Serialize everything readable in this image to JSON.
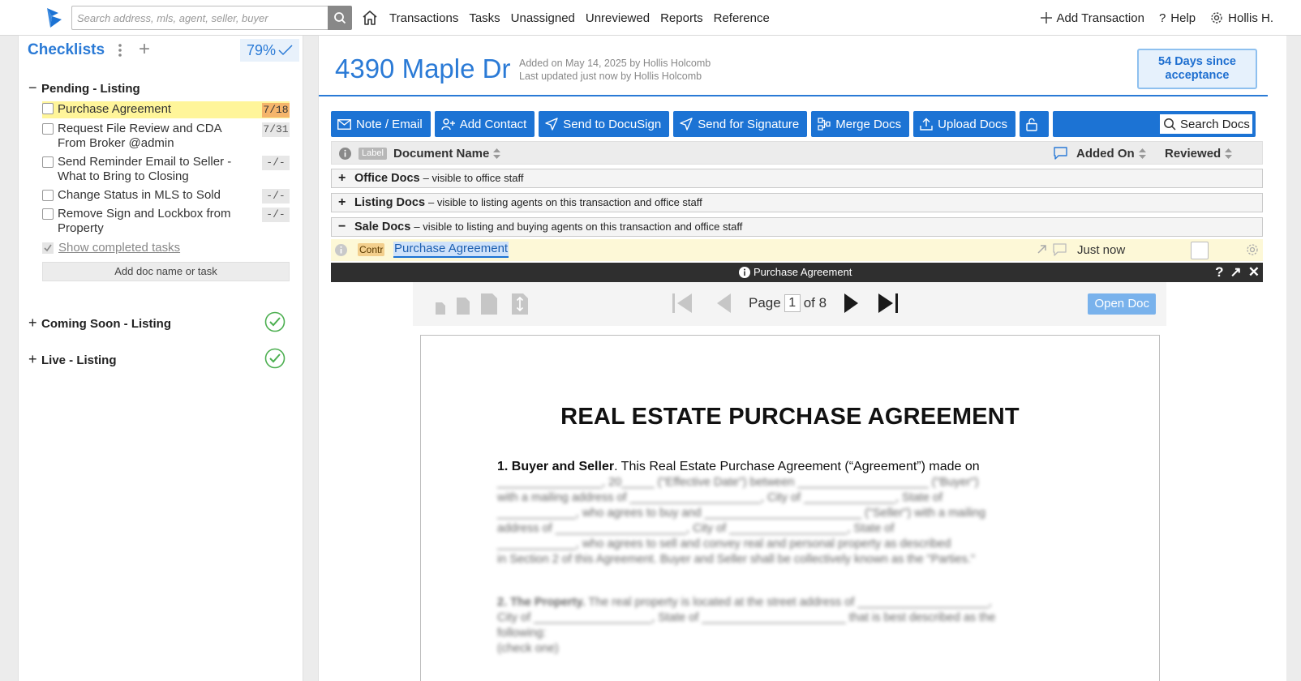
{
  "topbar": {
    "search_placeholder": "Search address, mls, agent, seller, buyer",
    "nav_links": [
      "Transactions",
      "Tasks",
      "Unassigned",
      "Unreviewed",
      "Reports",
      "Reference"
    ],
    "add_transaction": "Add Transaction",
    "help": "Help",
    "user": "Hollis H."
  },
  "sidebar": {
    "title": "Checklists",
    "percent": "79%",
    "pending_group": "Pending - Listing",
    "tasks": [
      {
        "label": "Purchase Agreement",
        "due": "7/18",
        "highlighted": true
      },
      {
        "label": "Request File Review and CDA From Broker @admin",
        "due": "7/31"
      },
      {
        "label": "Send Reminder Email to Seller - What to Bring to Closing",
        "due": "-/-"
      },
      {
        "label": "Change Status in MLS to Sold",
        "due": "-/-"
      },
      {
        "label": "Remove Sign and Lockbox from Property",
        "due": "-/-"
      }
    ],
    "show_completed": "Show completed tasks",
    "add_task": "Add doc name or task",
    "coming_soon_group": "Coming Soon - Listing",
    "live_group": "Live - Listing"
  },
  "main": {
    "address": "4390 Maple Dr",
    "added_on": "Added on May 14, 2025 by Hollis Holcomb",
    "last_updated": "Last updated just now by Hollis Holcomb",
    "days_badge": "54 Days since acceptance",
    "toolbar": {
      "note_email": "Note / Email",
      "add_contact": "Add Contact",
      "send_docusign": "Send to DocuSign",
      "send_signature": "Send for Signature",
      "merge_docs": "Merge Docs",
      "upload_docs": "Upload Docs",
      "search_docs": "Search Docs"
    },
    "table_header": {
      "label_tag": "Label",
      "document_name": "Document Name",
      "added_on": "Added On",
      "reviewed": "Reviewed"
    },
    "sections": [
      {
        "sign": "+",
        "name": "Office Docs",
        "desc": "– visible to office staff"
      },
      {
        "sign": "+",
        "name": "Listing Docs",
        "desc": "– visible to listing agents on this transaction and office staff"
      },
      {
        "sign": "−",
        "name": "Sale Docs",
        "desc": "– visible to listing and buying agents on this transaction and office staff"
      }
    ],
    "doc_row": {
      "tag": "Contr",
      "name": "Purchase Agreement",
      "added": "Just now"
    },
    "viewer": {
      "title": "Purchase Agreement",
      "page_label": "Page",
      "page_value": "1",
      "of_label": "of 8",
      "open_doc": "Open Doc"
    },
    "document": {
      "heading": "REAL ESTATE PURCHASE AGREEMENT",
      "section1_lead": "1. Buyer and Seller",
      "section1_text": ". This Real Estate Purchase Agreement (“Agreement”) made on"
    }
  },
  "colors": {
    "accent": "#1c73d4",
    "title_blue": "#2a7ad6",
    "highlight": "#fff59a",
    "due_highlight": "#f5b56b",
    "done_green": "#4caf50"
  }
}
